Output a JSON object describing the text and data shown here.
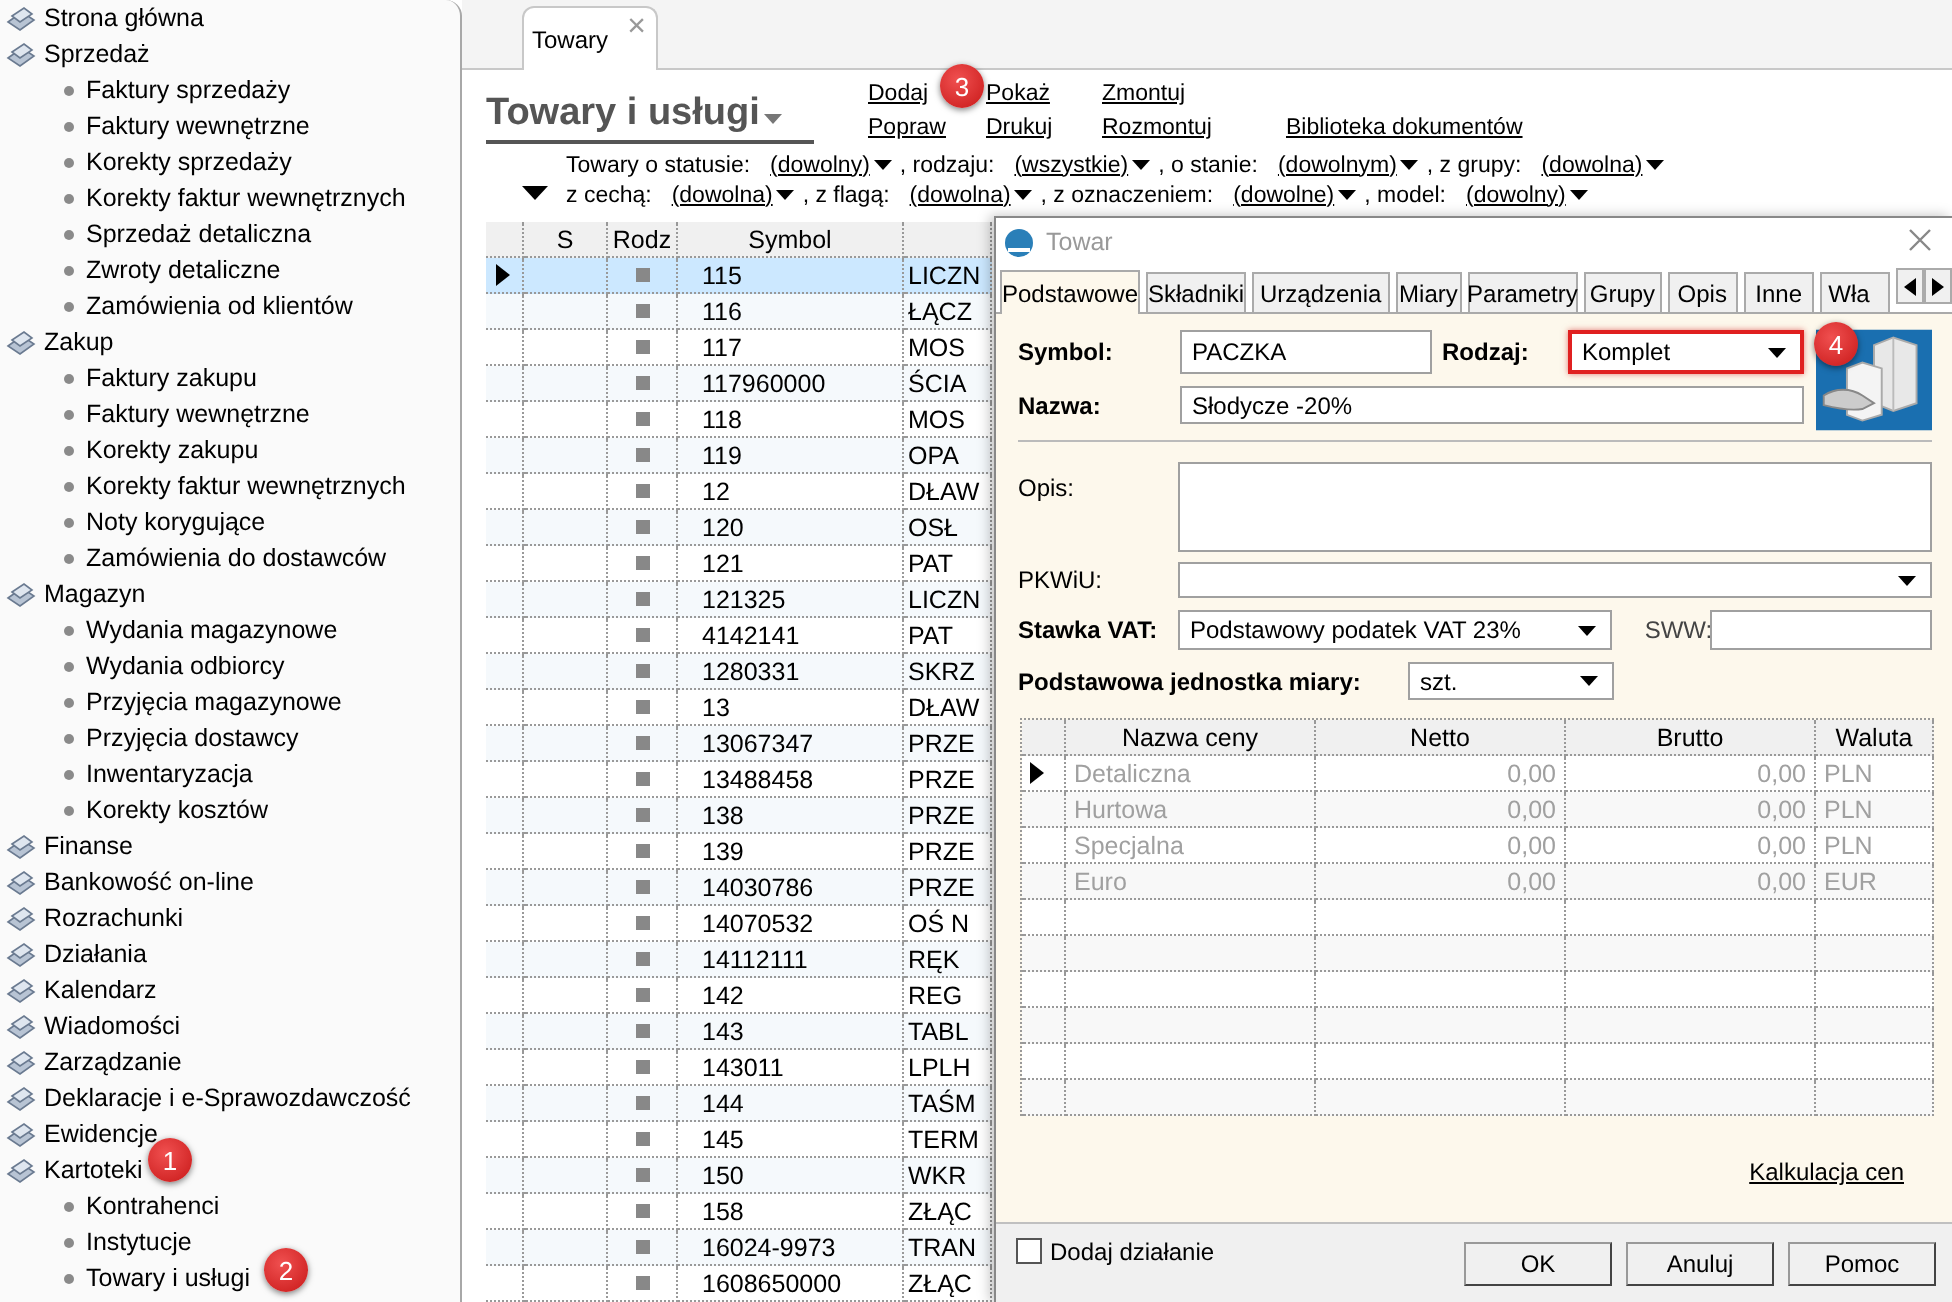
{
  "sidebar": {
    "items": [
      {
        "label": "Strona główna"
      },
      {
        "label": "Sprzedaż",
        "children": [
          {
            "label": "Faktury sprzedaży"
          },
          {
            "label": "Faktury wewnętrzne"
          },
          {
            "label": "Korekty sprzedaży"
          },
          {
            "label": "Korekty faktur wewnętrznych"
          },
          {
            "label": "Sprzedaż detaliczna"
          },
          {
            "label": "Zwroty detaliczne"
          },
          {
            "label": "Zamówienia od klientów"
          }
        ]
      },
      {
        "label": "Zakup",
        "children": [
          {
            "label": "Faktury zakupu"
          },
          {
            "label": "Faktury wewnętrzne"
          },
          {
            "label": "Korekty zakupu"
          },
          {
            "label": "Korekty faktur wewnętrznych"
          },
          {
            "label": "Noty korygujące"
          },
          {
            "label": "Zamówienia do dostawców"
          }
        ]
      },
      {
        "label": "Magazyn",
        "children": [
          {
            "label": "Wydania magazynowe"
          },
          {
            "label": "Wydania odbiorcy"
          },
          {
            "label": "Przyjęcia magazynowe"
          },
          {
            "label": "Przyjęcia dostawcy"
          },
          {
            "label": "Inwentaryzacja"
          },
          {
            "label": "Korekty kosztów"
          }
        ]
      },
      {
        "label": "Finanse"
      },
      {
        "label": "Bankowość on-line"
      },
      {
        "label": "Rozrachunki"
      },
      {
        "label": "Działania"
      },
      {
        "label": "Kalendarz"
      },
      {
        "label": "Wiadomości"
      },
      {
        "label": "Zarządzanie"
      },
      {
        "label": "Deklaracje i e-Sprawozdawczość"
      },
      {
        "label": "Ewidencje"
      },
      {
        "label": "Kartoteki",
        "children": [
          {
            "label": "Kontrahenci"
          },
          {
            "label": "Instytucje"
          },
          {
            "label": "Towary i usługi"
          }
        ]
      }
    ]
  },
  "tab": {
    "label": "Towary",
    "close": "×"
  },
  "header": {
    "title": "Towary i usługi",
    "actions": [
      {
        "top": "Dodaj",
        "bottom": "Popraw"
      },
      {
        "top": "Pokaż",
        "bottom": "Drukuj"
      },
      {
        "top": "Zmontuj",
        "bottom": "Rozmontuj"
      },
      {
        "bottom": "Biblioteka dokumentów"
      }
    ]
  },
  "filters": [
    [
      {
        "kind": "label",
        "text": "Towary o statusie:"
      },
      {
        "kind": "dropdown",
        "text": "(dowolny)"
      },
      {
        "kind": "label",
        "text": ", rodzaju:"
      },
      {
        "kind": "dropdown",
        "text": "(wszystkie)"
      },
      {
        "kind": "label",
        "text": ", o stanie:"
      },
      {
        "kind": "dropdown",
        "text": "(dowolnym)"
      },
      {
        "kind": "label",
        "text": ", z grupy:"
      },
      {
        "kind": "dropdown",
        "text": "(dowolna)"
      }
    ],
    [
      {
        "kind": "label",
        "text": "z cechą:"
      },
      {
        "kind": "dropdown",
        "text": "(dowolna)"
      },
      {
        "kind": "label",
        "text": ", z flagą:"
      },
      {
        "kind": "dropdown",
        "text": "(dowolna)"
      },
      {
        "kind": "label",
        "text": ", z oznaczeniem:"
      },
      {
        "kind": "dropdown",
        "text": "(dowolne)"
      },
      {
        "kind": "label",
        "text": ", model:"
      },
      {
        "kind": "dropdown",
        "text": "(dowolny)"
      }
    ]
  ],
  "table": {
    "columns": [
      "S",
      "Rodz",
      "Symbol"
    ],
    "rows": [
      {
        "symbol": "115",
        "name": "LICZN",
        "selected": true
      },
      {
        "symbol": "116",
        "name": "ŁĄCZ",
        "selected": false
      },
      {
        "symbol": "117",
        "name": "MOS",
        "selected": false
      },
      {
        "symbol": "117960000",
        "name": "ŚCIA",
        "selected": false
      },
      {
        "symbol": "118",
        "name": "MOS",
        "selected": false
      },
      {
        "symbol": "119",
        "name": "OPA",
        "selected": false
      },
      {
        "symbol": "12",
        "name": "DŁAW",
        "selected": false
      },
      {
        "symbol": "120",
        "name": "OSŁ",
        "selected": false
      },
      {
        "symbol": "121",
        "name": "PAT",
        "selected": false
      },
      {
        "symbol": "121325",
        "name": "LICZN",
        "selected": false
      },
      {
        "symbol": "4142141",
        "name": "PAT",
        "selected": false
      },
      {
        "symbol": "1280331",
        "name": "SKRZ",
        "selected": false
      },
      {
        "symbol": "13",
        "name": "DŁAW",
        "selected": false
      },
      {
        "symbol": "13067347",
        "name": "PRZE",
        "selected": false
      },
      {
        "symbol": "13488458",
        "name": "PRZE",
        "selected": false
      },
      {
        "symbol": "138",
        "name": "PRZE",
        "selected": false
      },
      {
        "symbol": "139",
        "name": "PRZE",
        "selected": false
      },
      {
        "symbol": "14030786",
        "name": "PRZE",
        "selected": false
      },
      {
        "symbol": "14070532",
        "name": "OŚ N",
        "selected": false
      },
      {
        "symbol": "14112111",
        "name": "RĘK",
        "selected": false
      },
      {
        "symbol": "142",
        "name": "REG",
        "selected": false
      },
      {
        "symbol": "143",
        "name": "TABL",
        "selected": false
      },
      {
        "symbol": "143011",
        "name": "LPLH",
        "selected": false
      },
      {
        "symbol": "144",
        "name": "TAŚM",
        "selected": false
      },
      {
        "symbol": "145",
        "name": "TERM",
        "selected": false
      },
      {
        "symbol": "150",
        "name": "WKR",
        "selected": false
      },
      {
        "symbol": "158",
        "name": "ZŁĄC",
        "selected": false
      },
      {
        "symbol": "16024-9973",
        "name": "TRAN",
        "selected": false
      },
      {
        "symbol": "1608650000",
        "name": "ZŁĄC",
        "selected": false
      }
    ]
  },
  "dialog": {
    "title": "Towar",
    "tabs": [
      {
        "label": "Podstawowe",
        "selected": true
      },
      {
        "label": "Składniki",
        "selected": false
      },
      {
        "label": "Urządzenia",
        "selected": false
      },
      {
        "label": "Miary",
        "selected": false
      },
      {
        "label": "Parametry",
        "selected": false
      },
      {
        "label": "Grupy",
        "selected": false
      },
      {
        "label": "Opis",
        "selected": false
      },
      {
        "label": "Inne",
        "selected": false
      },
      {
        "label": "Wła",
        "selected": false
      }
    ],
    "symbol": {
      "label": "Symbol:",
      "value": "PACZKA"
    },
    "rodzaj": {
      "label": "Rodzaj:",
      "value": "Komplet",
      "highlighted": true
    },
    "nazwa": {
      "label": "Nazwa:",
      "value": "Słodycze -20%"
    },
    "opis": {
      "label": "Opis:"
    },
    "pkwiu": {
      "label": "PKWiU:"
    },
    "vat": {
      "label": "Stawka VAT:",
      "value": "Podstawowy podatek VAT 23%"
    },
    "sww": {
      "label": "SWW:"
    },
    "unit": {
      "label": "Podstawowa jednostka miary:",
      "value": "szt."
    },
    "prices": {
      "disabled": true,
      "columns": [
        "Nazwa ceny",
        "Netto",
        "Brutto",
        "Waluta"
      ],
      "rows": [
        {
          "name": "Detaliczna",
          "net": "0,00",
          "gross": "0,00",
          "currency": "PLN",
          "selected": true
        },
        {
          "name": "Hurtowa",
          "net": "0,00",
          "gross": "0,00",
          "currency": "PLN",
          "selected": false
        },
        {
          "name": "Specjalna",
          "net": "0,00",
          "gross": "0,00",
          "currency": "PLN",
          "selected": false
        },
        {
          "name": "Euro",
          "net": "0,00",
          "gross": "0,00",
          "currency": "EUR",
          "selected": false
        }
      ]
    },
    "calc_link": "Kalkulacja cen",
    "add_action": {
      "label": "Dodaj działanie",
      "checked": false
    },
    "buttons": [
      "OK",
      "Anuluj",
      "Pomoc"
    ]
  },
  "annotations": [
    {
      "label": "1"
    },
    {
      "label": "2"
    },
    {
      "label": "3"
    },
    {
      "label": "4"
    }
  ]
}
